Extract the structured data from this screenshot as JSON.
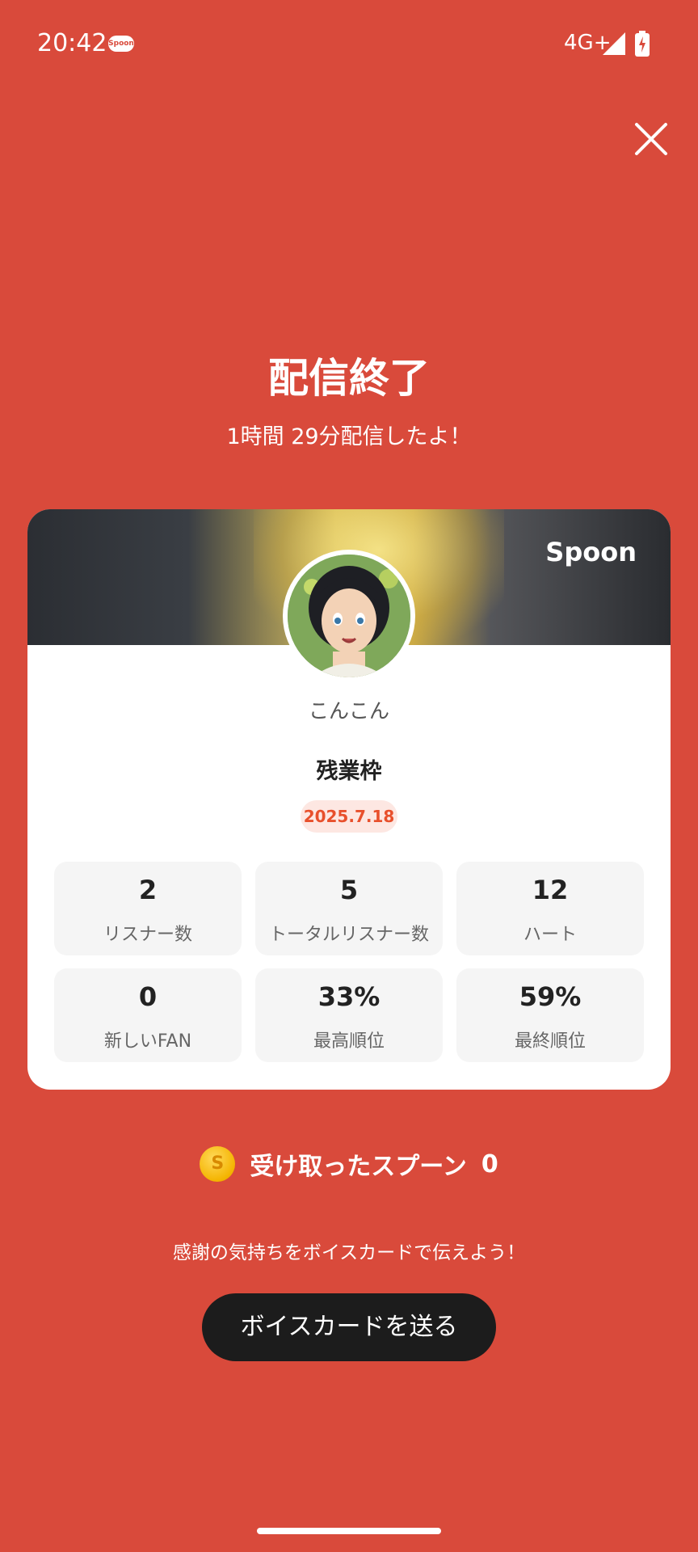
{
  "status_bar": {
    "time": "20:42",
    "app_badge": "Spoon",
    "network": "4G+"
  },
  "header": {
    "title": "配信終了",
    "subtitle": "1時間 29分配信したよ！"
  },
  "card": {
    "logo": "Spoon",
    "username": "こんこん",
    "show_title": "残業枠",
    "date": "2025.7.18",
    "stats": [
      {
        "value": "2",
        "label": "リスナー数"
      },
      {
        "value": "5",
        "label": "トータルリスナー数"
      },
      {
        "value": "12",
        "label": "ハート"
      },
      {
        "value": "0",
        "label": "新しいFAN"
      },
      {
        "value": "33%",
        "label": "最高順位"
      },
      {
        "value": "59%",
        "label": "最終順位"
      }
    ]
  },
  "spoons": {
    "coin_symbol": "S",
    "label": "受け取ったスプーン",
    "count": "0"
  },
  "thanks_text": "感謝の気持ちをボイスカードで伝えよう！",
  "voice_button": "ボイスカードを送る",
  "colors": {
    "background": "#d94a3b",
    "accent": "#e8502c",
    "button": "#1c1c1c"
  }
}
